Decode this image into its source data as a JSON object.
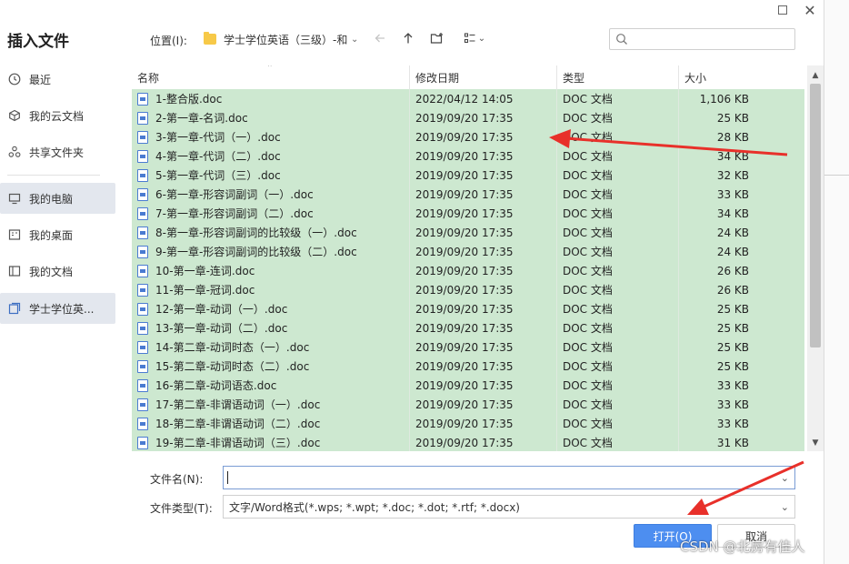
{
  "dialog": {
    "title": "插入文件"
  },
  "sidebar": {
    "items": [
      {
        "label": "最近",
        "icon": "clock-icon"
      },
      {
        "label": "我的云文档",
        "icon": "cloud-cube-icon"
      },
      {
        "label": "共享文件夹",
        "icon": "share-people-icon"
      },
      {
        "label": "我的电脑",
        "icon": "monitor-icon"
      },
      {
        "label": "我的桌面",
        "icon": "desktop-icon"
      },
      {
        "label": "我的文档",
        "icon": "document-folder-icon"
      },
      {
        "label": "学士学位英...",
        "icon": "folder-copy-icon"
      }
    ]
  },
  "location": {
    "label": "位置(I):",
    "path": "学士学位英语（三级）-和"
  },
  "columns": {
    "name": "名称",
    "date": "修改日期",
    "type": "类型",
    "size": "大小"
  },
  "files": [
    {
      "name": "1-整合版.doc",
      "date": "2022/04/12 14:05",
      "type": "DOC 文档",
      "size": "1,106 KB"
    },
    {
      "name": "2-第一章-名词.doc",
      "date": "2019/09/20 17:35",
      "type": "DOC 文档",
      "size": "25 KB"
    },
    {
      "name": "3-第一章-代词（一）.doc",
      "date": "2019/09/20 17:35",
      "type": "DOC 文档",
      "size": "28 KB"
    },
    {
      "name": "4-第一章-代词（二）.doc",
      "date": "2019/09/20 17:35",
      "type": "DOC 文档",
      "size": "34 KB"
    },
    {
      "name": "5-第一章-代词（三）.doc",
      "date": "2019/09/20 17:35",
      "type": "DOC 文档",
      "size": "32 KB"
    },
    {
      "name": "6-第一章-形容词副词（一）.doc",
      "date": "2019/09/20 17:35",
      "type": "DOC 文档",
      "size": "33 KB"
    },
    {
      "name": "7-第一章-形容词副词（二）.doc",
      "date": "2019/09/20 17:35",
      "type": "DOC 文档",
      "size": "34 KB"
    },
    {
      "name": "8-第一章-形容词副词的比较级（一）.doc",
      "date": "2019/09/20 17:35",
      "type": "DOC 文档",
      "size": "24 KB"
    },
    {
      "name": "9-第一章-形容词副词的比较级（二）.doc",
      "date": "2019/09/20 17:35",
      "type": "DOC 文档",
      "size": "24 KB"
    },
    {
      "name": "10-第一章-连词.doc",
      "date": "2019/09/20 17:35",
      "type": "DOC 文档",
      "size": "26 KB"
    },
    {
      "name": "11-第一章-冠词.doc",
      "date": "2019/09/20 17:35",
      "type": "DOC 文档",
      "size": "26 KB"
    },
    {
      "name": "12-第一章-动词（一）.doc",
      "date": "2019/09/20 17:35",
      "type": "DOC 文档",
      "size": "25 KB"
    },
    {
      "name": "13-第一章-动词（二）.doc",
      "date": "2019/09/20 17:35",
      "type": "DOC 文档",
      "size": "25 KB"
    },
    {
      "name": "14-第二章-动词时态（一）.doc",
      "date": "2019/09/20 17:35",
      "type": "DOC 文档",
      "size": "25 KB"
    },
    {
      "name": "15-第二章-动词时态（二）.doc",
      "date": "2019/09/20 17:35",
      "type": "DOC 文档",
      "size": "25 KB"
    },
    {
      "name": "16-第二章-动词语态.doc",
      "date": "2019/09/20 17:35",
      "type": "DOC 文档",
      "size": "33 KB"
    },
    {
      "name": "17-第二章-非谓语动词（一）.doc",
      "date": "2019/09/20 17:35",
      "type": "DOC 文档",
      "size": "33 KB"
    },
    {
      "name": "18-第二章-非谓语动词（二）.doc",
      "date": "2019/09/20 17:35",
      "type": "DOC 文档",
      "size": "33 KB"
    },
    {
      "name": "19-第二章-非谓语动词（三）.doc",
      "date": "2019/09/20 17:35",
      "type": "DOC 文档",
      "size": "31 KB"
    }
  ],
  "bottom": {
    "filename_label": "文件名(N):",
    "filename_value": "",
    "filetype_label": "文件类型(T):",
    "filetype_value": "文字/Word格式(*.wps; *.wpt; *.doc; *.dot; *.rtf; *.docx)",
    "open_label": "打开(O)",
    "cancel_label": "取消"
  },
  "watermark": "CSDN @北房有佳人",
  "colors": {
    "selection": "#cde8d0",
    "primary_button": "#4d8ef0",
    "annotation_arrow": "#e8302a",
    "folder": "#f7c948"
  }
}
